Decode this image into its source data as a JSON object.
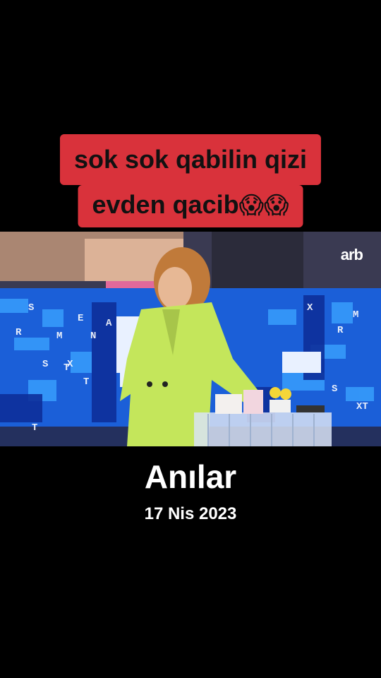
{
  "caption": {
    "line1": "sok sok qabilin qizi",
    "line2_text": "evden qacib",
    "line2_emoji": "😱😱"
  },
  "video": {
    "channel_logo": "arb",
    "screen_letters": [
      "S",
      "T",
      "X",
      "R",
      "E",
      "M",
      "A",
      "N",
      "S",
      "X",
      "T",
      "R",
      "S",
      "XT",
      "M",
      "T"
    ]
  },
  "overlay": {
    "title": "Anılar",
    "date": "17 Nis 2023"
  },
  "colors": {
    "caption_bg": "#d9323b",
    "screen_blue": "#1b5fd8",
    "jacket": "#c4e65b"
  }
}
